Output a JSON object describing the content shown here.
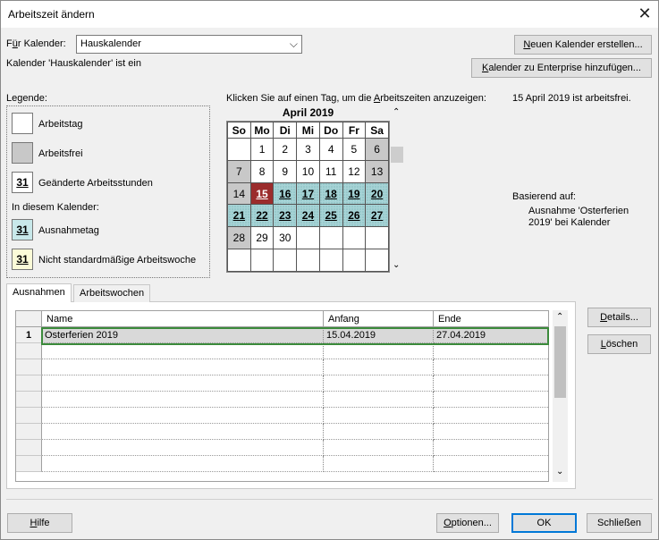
{
  "window": {
    "title": "Arbeitszeit ändern",
    "close_glyph": "✕"
  },
  "calendar_select": {
    "label_prefix": "F",
    "label_u": "ü",
    "label_rest": "r Kalender:",
    "value": "Hauskalender"
  },
  "status_line": "Kalender 'Hauskalender' ist ein",
  "top_buttons": {
    "new_u": "N",
    "new_rest": "euen Kalender erstellen...",
    "enterprise_u": "K",
    "enterprise_rest": "alender zu Enterprise hinzufügen..."
  },
  "legend": {
    "title": "Legende:",
    "work_day": "Arbeitstag",
    "non_working": "Arbeitsfrei",
    "changed_hours": "Geänderte Arbeitsstunden",
    "in_calendar": "In diesem Kalender:",
    "exception_day": "Ausnahmetag",
    "nonstandard_week": "Nicht standardmäßige Arbeitswoche",
    "sample_number": "31"
  },
  "calendar": {
    "instruction_a": "Klicken Sie auf einen Tag, um die ",
    "instruction_u": "A",
    "instruction_b": "rbeitszeiten anzuzeigen:",
    "month": "April 2019",
    "weekdays": [
      "So",
      "Mo",
      "Di",
      "Mi",
      "Do",
      "Fr",
      "Sa"
    ],
    "weeks": [
      [
        "",
        "1",
        "2",
        "3",
        "4",
        "5",
        "6"
      ],
      [
        "7",
        "8",
        "9",
        "10",
        "11",
        "12",
        "13"
      ],
      [
        "14",
        "15",
        "16",
        "17",
        "18",
        "19",
        "20"
      ],
      [
        "21",
        "22",
        "23",
        "24",
        "25",
        "26",
        "27"
      ],
      [
        "28",
        "29",
        "30",
        "",
        "",
        "",
        ""
      ],
      [
        "",
        "",
        "",
        "",
        "",
        "",
        ""
      ]
    ],
    "selected_day": "15",
    "exception_days": [
      "15",
      "16",
      "17",
      "18",
      "19",
      "20",
      "21",
      "22",
      "23",
      "24",
      "25",
      "26",
      "27"
    ],
    "free_days": [
      "6",
      "7",
      "13",
      "14",
      "20",
      "21",
      "27",
      "28"
    ]
  },
  "info": {
    "status": "15 April 2019 ist arbeitsfrei.",
    "based_on": "Basierend auf:",
    "based_line1": "Ausnahme 'Osterferien",
    "based_line2": "2019' bei Kalender"
  },
  "tabs": [
    {
      "label": "Ausnahmen",
      "active": true
    },
    {
      "label": "Arbeitswochen",
      "active": false
    }
  ],
  "exceptions_table": {
    "columns": [
      "Name",
      "Anfang",
      "Ende"
    ],
    "rows": [
      {
        "num": "1",
        "name": "Osterferien 2019",
        "start": "15.04.2019",
        "end": "27.04.2019"
      }
    ]
  },
  "side_buttons": {
    "details_u": "D",
    "details_rest": "etails...",
    "delete_u": "L",
    "delete_rest": "öschen"
  },
  "bottom_buttons": {
    "help_u": "H",
    "help_rest": "ilfe",
    "options_u": "O",
    "options_rest": "ptionen...",
    "ok": "OK",
    "close": "Schließen"
  }
}
